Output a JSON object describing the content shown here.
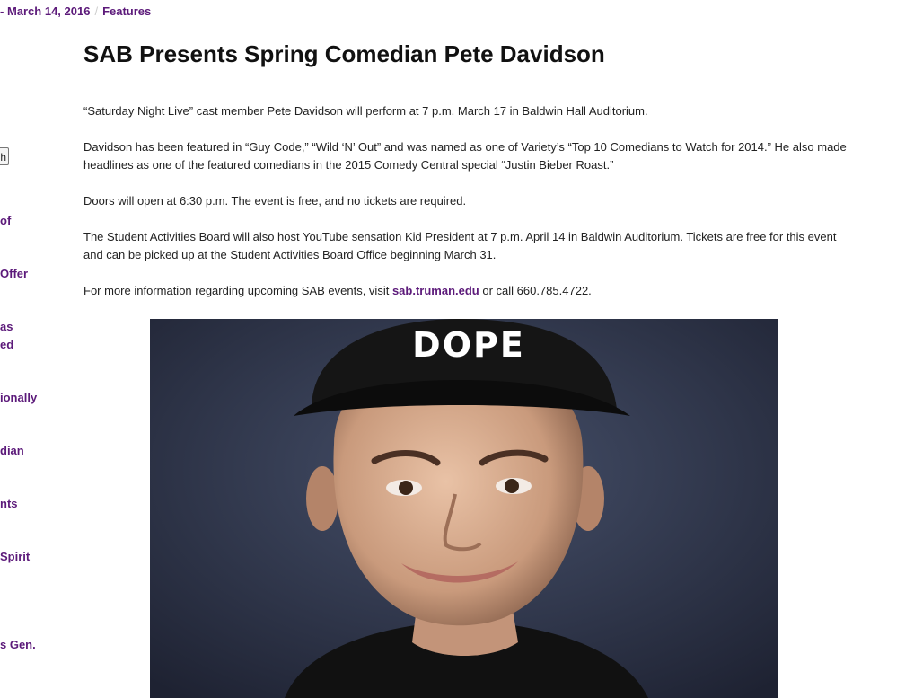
{
  "meta": {
    "date": "- March 14, 2016",
    "separator": "/",
    "category": "Features"
  },
  "sidebar": {
    "button_label": "h",
    "links": [
      "of",
      "Offer",
      "as",
      "ed",
      "ionally",
      "dian",
      "nts",
      "Spirit",
      "s Gen."
    ]
  },
  "article": {
    "title": "SAB Presents Spring Comedian Pete Davidson",
    "paragraphs": [
      "“Saturday Night Live” cast member Pete Davidson will perform at 7 p.m. March 17 in Baldwin Hall Auditorium.",
      "Davidson has been featured in “Guy Code,” “Wild ‘N’ Out” and was named as one of Variety’s “Top 10 Comedians to Watch for 2014.” He also made headlines as one of the featured comedians in the 2015 Comedy Central special “Justin Bieber Roast.”",
      "Doors will open at 6:30 p.m. The event is free, and no tickets are required.",
      "The Student Activities Board will also host YouTube sensation Kid President at 7 p.m. April 14 in Baldwin Auditorium. Tickets are free for this event and can be picked up at the Student Activities Board Office beginning March 31."
    ],
    "contact_prefix": "For more information regarding upcoming SAB events, visit ",
    "contact_link": "sab.truman.edu ",
    "contact_suffix": "or call 660.785.4722.",
    "cap_text": "DOPE"
  },
  "colors": {
    "accent": "#5c1a7a",
    "photo_background": "#2b3144"
  }
}
